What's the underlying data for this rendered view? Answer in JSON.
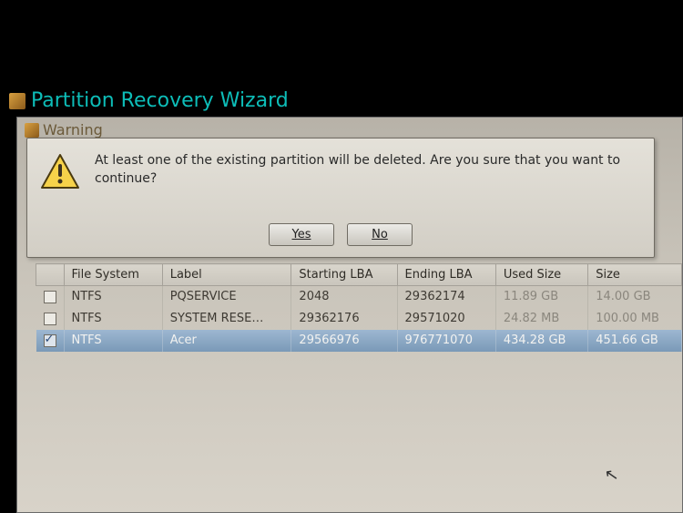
{
  "window": {
    "title": "Partition Recovery Wizard",
    "innerTitle": "Warning"
  },
  "dialog": {
    "message": "At least one of the existing partition will be deleted. Are you sure that you want to continue?",
    "yes": "Yes",
    "no": "No"
  },
  "table": {
    "headers": {
      "check": "",
      "fs": "File System",
      "label": "Label",
      "startLBA": "Starting LBA",
      "endLBA": "Ending LBA",
      "usedSize": "Used Size",
      "size": "Size"
    },
    "rows": [
      {
        "checked": false,
        "fs": "NTFS",
        "label": "PQSERVICE",
        "startLBA": "2048",
        "endLBA": "29362174",
        "usedSize": "11.89 GB",
        "size": "14.00 GB",
        "selected": false
      },
      {
        "checked": false,
        "fs": "NTFS",
        "label": "SYSTEM RESE…",
        "startLBA": "29362176",
        "endLBA": "29571020",
        "usedSize": "24.82 MB",
        "size": "100.00 MB",
        "selected": false
      },
      {
        "checked": true,
        "fs": "NTFS",
        "label": "Acer",
        "startLBA": "29566976",
        "endLBA": "976771070",
        "usedSize": "434.28 GB",
        "size": "451.66 GB",
        "selected": true
      }
    ]
  }
}
